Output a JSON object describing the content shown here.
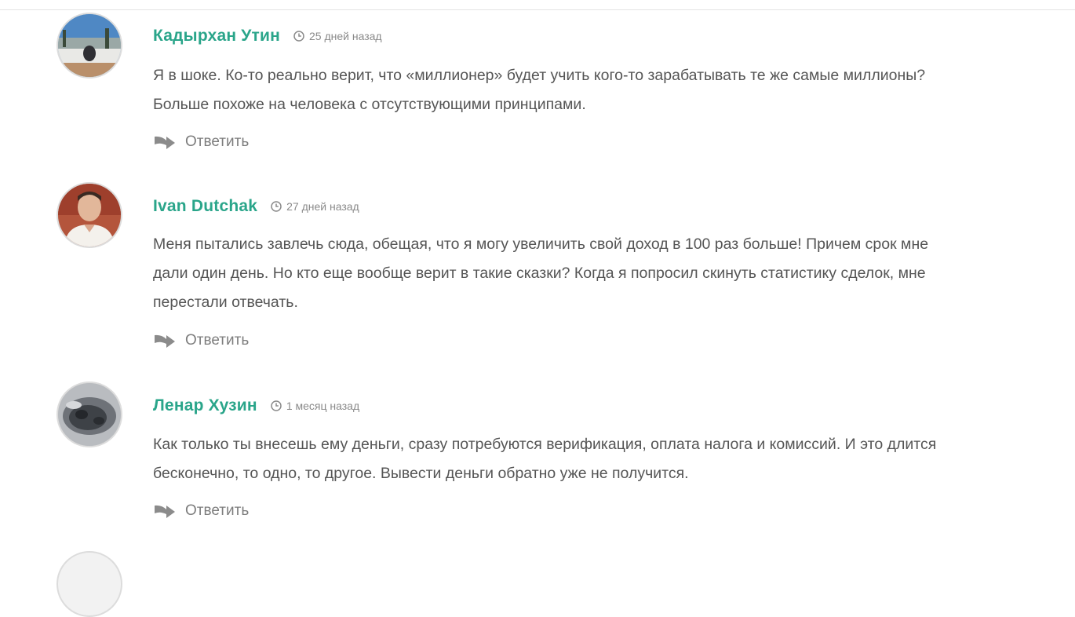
{
  "comments": [
    {
      "author": "Кадырхан Утин",
      "time": "25 дней назад",
      "text": "Я в шоке. Ко-то реально верит, что «миллионер» будет учить кого-то зарабатывать те же самые миллионы? Больше похоже на человека с отсутствующими принципами.",
      "reply_label": "Ответить",
      "avatar_icon": "avatar-landscape"
    },
    {
      "author": "Ivan Dutchak",
      "time": "27 дней назад",
      "text": "Меня пытались завлечь сюда, обещая, что я могу увеличить свой доход в 100 раз больше! Причем срок мне дали один день. Но кто еще вообще верит в такие сказки? Когда я попросил скинуть статистику сделок, мне перестали отвечать.",
      "reply_label": "Ответить",
      "avatar_icon": "avatar-person"
    },
    {
      "author": "Ленар Хузин",
      "time": "1 месяц назад",
      "text": "Как только ты внесешь ему деньги, сразу потребуются верификация, оплата налога и комиссий. И это длится бесконечно, то одно, то другое. Вывести деньги обратно уже не получится.",
      "reply_label": "Ответить",
      "avatar_icon": "avatar-blurred"
    }
  ],
  "icons": {
    "time": "clock-icon",
    "reply": "reply-arrow-icon"
  },
  "colors": {
    "author": "#2aa58a",
    "text": "#555555",
    "meta": "#8a8a8a"
  }
}
